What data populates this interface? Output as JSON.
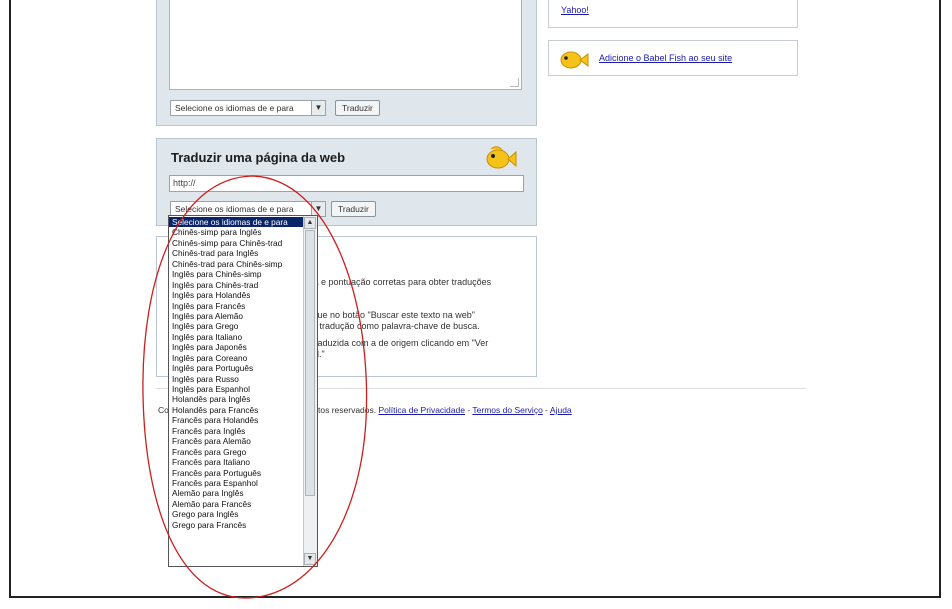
{
  "text_translate": {
    "lang_select_value": "Selecione os idiomas de e para",
    "translate_button": "Traduzir"
  },
  "web_translate": {
    "title": "Traduzir uma página da web",
    "url_value": "http://",
    "lang_select_value": "Selecione os idiomas de e para",
    "translate_button": "Traduzir"
  },
  "tips": {
    "line1": "ca e pontuação corretas para obter traduções",
    "line2": "clique no botão \"Buscar este texto na web\"",
    "line3": "a tradução como palavra-chave de busca.",
    "line4": "traduzida com a de origem clicando em \"Ver",
    "line5": "al.\""
  },
  "right_column": {
    "yahoo_link": "Yahoo!",
    "babel_link": "Adicione o Babel Fish ao seu site"
  },
  "footer": {
    "prefix": "Co",
    "rights": "tos reservados.",
    "privacy": "Política de Privacidade",
    "sep1": "-",
    "terms": "Termos do Serviço",
    "sep2": "-",
    "help": "Ajuda"
  },
  "dropdown": {
    "options": [
      "Selecione os idiomas de e para",
      "Chinês-simp para Inglês",
      "Chinês-simp para Chinês-trad",
      "Chinês-trad para Inglês",
      "Chinês-trad para Chinês-simp",
      "Inglês para Chinês-simp",
      "Inglês para Chinês-trad",
      "Inglês para Holandês",
      "Inglês para Francês",
      "Inglês para Alemão",
      "Inglês para Grego",
      "Inglês para Italiano",
      "Inglês para Japonês",
      "Inglês para Coreano",
      "Inglês para Português",
      "Inglês para Russo",
      "Inglês para Espanhol",
      "Holandês para Inglês",
      "Holandês para Francês",
      "Francês para Holandês",
      "Francês para Inglês",
      "Francês para Alemão",
      "Francês para Grego",
      "Francês para Italiano",
      "Francês para Português",
      "Francês para Espanhol",
      "Alemão para Inglês",
      "Alemão para Francês",
      "Grego para Inglês",
      "Grego para Francês"
    ],
    "selected_index": 0
  },
  "colors": {
    "panel_bg": "#dfe6ec",
    "selected_bg": "#0a246a",
    "annotation": "#cc1f1f",
    "link": "#1a1ab0"
  },
  "icons": [
    "fish-icon",
    "scroll-up-icon",
    "scroll-down-icon",
    "select-arrow-icon"
  ]
}
